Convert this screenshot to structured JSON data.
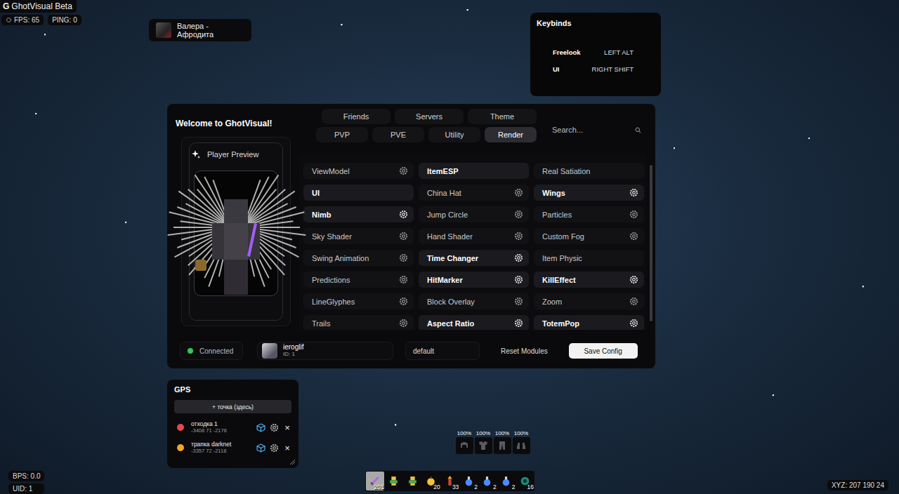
{
  "hud": {
    "brand": {
      "logo": "G",
      "title": "GhotVisual Beta"
    },
    "stats": [
      {
        "label": "FPS: 65",
        "icon": true
      },
      {
        "label": "PING: 0",
        "icon": false
      }
    ],
    "bottom_left": [
      "BPS: 0.0",
      "UID: 1"
    ],
    "coords": "XYZ: 207 190 24"
  },
  "music": {
    "track": "Валера - Афродита"
  },
  "keybinds": {
    "title": "Keybinds",
    "items": [
      {
        "action": "Freelook",
        "key": "LEFT ALT"
      },
      {
        "action": "UI",
        "key": "RIGHT SHIFT"
      }
    ]
  },
  "menu": {
    "title": "Welcome to GhotVisual!",
    "tabs_top": [
      {
        "label": "Friends",
        "selected": false
      },
      {
        "label": "Servers",
        "selected": false
      },
      {
        "label": "Theme",
        "selected": false
      }
    ],
    "tabs_bottom": [
      {
        "label": "PVP",
        "selected": false
      },
      {
        "label": "PVE",
        "selected": false
      },
      {
        "label": "Utility",
        "selected": false
      },
      {
        "label": "Render",
        "selected": true
      }
    ],
    "search": {
      "placeholder": "Search..."
    },
    "preview": {
      "title": "Player Preview"
    },
    "modules": [
      {
        "name": "ViewModel",
        "enabled": false,
        "settings": true
      },
      {
        "name": "ItemESP",
        "enabled": true,
        "settings": false
      },
      {
        "name": "Real Satiation",
        "enabled": false,
        "settings": false
      },
      {
        "name": "UI",
        "enabled": true,
        "settings": false
      },
      {
        "name": "China Hat",
        "enabled": false,
        "settings": true
      },
      {
        "name": "Wings",
        "enabled": true,
        "settings": true
      },
      {
        "name": "Nimb",
        "enabled": true,
        "settings": true
      },
      {
        "name": "Jump Circle",
        "enabled": false,
        "settings": true
      },
      {
        "name": "Particles",
        "enabled": false,
        "settings": true
      },
      {
        "name": "Sky Shader",
        "enabled": false,
        "settings": true
      },
      {
        "name": "Hand Shader",
        "enabled": false,
        "settings": true
      },
      {
        "name": "Custom Fog",
        "enabled": false,
        "settings": true
      },
      {
        "name": "Swing Animation",
        "enabled": false,
        "settings": true
      },
      {
        "name": "Time Changer",
        "enabled": true,
        "settings": true
      },
      {
        "name": "Item Physic",
        "enabled": false,
        "settings": false
      },
      {
        "name": "Predictions",
        "enabled": false,
        "settings": true
      },
      {
        "name": "HitMarker",
        "enabled": true,
        "settings": true
      },
      {
        "name": "KillEffect",
        "enabled": true,
        "settings": true
      },
      {
        "name": "LineGlyphes",
        "enabled": false,
        "settings": true
      },
      {
        "name": "Block Overlay",
        "enabled": false,
        "settings": true
      },
      {
        "name": "Zoom",
        "enabled": false,
        "settings": true
      },
      {
        "name": "Trails",
        "enabled": false,
        "settings": true
      },
      {
        "name": "Aspect Ratio",
        "enabled": true,
        "settings": true
      },
      {
        "name": "TotemPop",
        "enabled": true,
        "settings": true
      }
    ],
    "scroll": {
      "level": 0.95
    },
    "status": {
      "label": "Connected",
      "connected": true
    },
    "user": {
      "name": "ieroglif",
      "id": "ID: 1"
    },
    "config": "default",
    "reset_button": "Reset Modules",
    "save_button": "Save Config"
  },
  "gps": {
    "title": "GPS",
    "add_button": "+ точка (здесь)",
    "waypoints": [
      {
        "name": "отходка 1",
        "coords": "-3408 71 -2176",
        "color": "#e5484d",
        "remove": "×"
      },
      {
        "name": "трапка darknet",
        "coords": "-3357 72 -2118",
        "color": "#f5a524",
        "remove": "×"
      }
    ]
  },
  "armor": [
    {
      "kind": "helmet",
      "durability": "100%"
    },
    {
      "kind": "chestplate",
      "durability": "100%"
    },
    {
      "kind": "leggings",
      "durability": "100%"
    },
    {
      "kind": "boots",
      "durability": "100%"
    }
  ],
  "hotbar": [
    {
      "kind": "sword",
      "count": "201",
      "selected": true
    },
    {
      "kind": "totem",
      "count": "",
      "selected": false
    },
    {
      "kind": "totem",
      "count": "",
      "selected": false
    },
    {
      "kind": "apple",
      "count": "20",
      "selected": false
    },
    {
      "kind": "firework",
      "count": "33",
      "selected": false
    },
    {
      "kind": "potion",
      "count": "2",
      "selected": false
    },
    {
      "kind": "potion",
      "count": "2",
      "selected": false
    },
    {
      "kind": "potion",
      "count": "2",
      "selected": false
    },
    {
      "kind": "pearl",
      "count": "16",
      "selected": false
    }
  ]
}
